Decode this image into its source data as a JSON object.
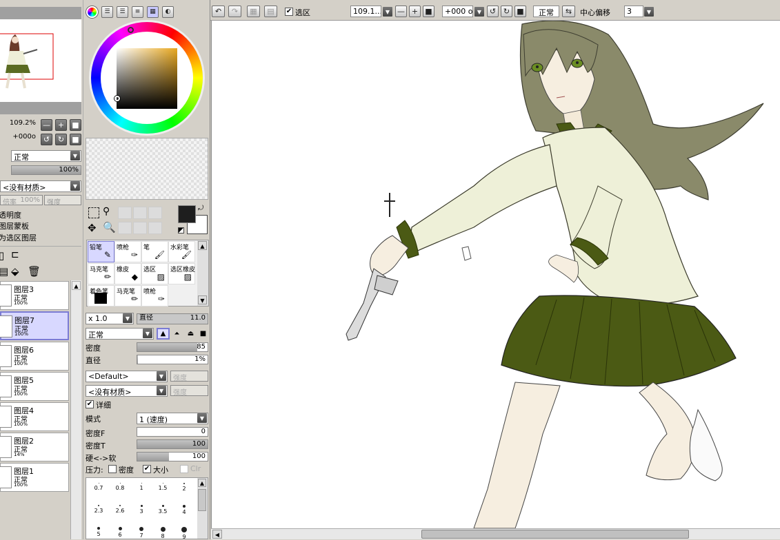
{
  "top_toolbar": {
    "selection_check": "✔",
    "selection_label": "选区",
    "zoom_value": "109.1...",
    "rotate_value": "+000 o",
    "blend_mode": "正常",
    "center_offset_label": "中心偏移",
    "center_offset_value": "3"
  },
  "navigator": {
    "zoom_value": "109.2%",
    "rotate_value": "+000o",
    "blend_mode": "正常",
    "opacity_value": "100%",
    "texture": "<没有材质>",
    "texture_scale_label": "倍率",
    "texture_scale_value": "100%",
    "texture_strength": "强度",
    "option_transparency": "透明度",
    "option_layer_template": "图层蒙板",
    "option_selection_layer": "为选区图层"
  },
  "layers": [
    {
      "name": "图层3",
      "mode": "正常",
      "opacity": "100%"
    },
    {
      "name": "图层7",
      "mode": "正常",
      "opacity": "100%"
    },
    {
      "name": "图层6",
      "mode": "正常",
      "opacity": "100%"
    },
    {
      "name": "图层5",
      "mode": "正常",
      "opacity": "100%"
    },
    {
      "name": "图层4",
      "mode": "正常",
      "opacity": "100%"
    },
    {
      "name": "图层2",
      "mode": "正常",
      "opacity": "14%"
    },
    {
      "name": "图层1",
      "mode": "正常",
      "opacity": "100%"
    }
  ],
  "tools": [
    {
      "name": "铅笔",
      "icon": "pencil-icon"
    },
    {
      "name": "喷枪",
      "icon": "airbrush-icon"
    },
    {
      "name": "笔",
      "icon": "brush-icon"
    },
    {
      "name": "水彩笔",
      "icon": "watercolor-icon"
    },
    {
      "name": "马克笔",
      "icon": "marker-icon"
    },
    {
      "name": "橡皮",
      "icon": "eraser-icon"
    },
    {
      "name": "选区",
      "icon": "select-pen-icon"
    },
    {
      "name": "选区橡皮",
      "icon": "select-eraser-icon"
    },
    {
      "name": "着色笔",
      "icon": "fill-icon"
    },
    {
      "name": "马克笔",
      "icon": "marker-icon"
    },
    {
      "name": "喷枪",
      "icon": "airbrush-icon"
    }
  ],
  "brush": {
    "size_mult": "x 1.0",
    "diameter_label": "直径",
    "diameter_value": "11.0",
    "blend_mode": "正常",
    "density_label": "密度",
    "density_value": "85",
    "density_level": 0.85,
    "min_diameter_label": "直径",
    "min_diameter_value": "1%",
    "shape": "<Default>",
    "shape_strength": "强度",
    "texture": "<没有材质>",
    "texture_strength": "强度",
    "detail_check": "✔",
    "detail_label": "详细",
    "mode_label": "模式",
    "mode_value": "1 (速度)",
    "density_f_label": "密度F",
    "density_f_value": "0",
    "density_f_level": 0,
    "density_t_label": "密度T",
    "density_t_value": "100",
    "density_t_level": 1,
    "hard_soft_label": "硬<->软",
    "hard_soft_value": "100",
    "hard_soft_level": 0.45,
    "pressure_label": "压力:",
    "pressure_density": "密度",
    "pressure_size_check": "✔",
    "pressure_size": "大小",
    "pressure_clr": "Clr"
  },
  "brush_sizes": [
    "0.7",
    "0.8",
    "1",
    "1.5",
    "2",
    "2.3",
    "2.6",
    "3",
    "3.5",
    "4",
    "5",
    "6",
    "7",
    "8",
    "9"
  ],
  "colors": {
    "accent": "#7b7bd4",
    "foreground": "#1e1e1e",
    "background": "#ffffff",
    "canvas": "#ffffff",
    "ui": "#d4d0c8"
  }
}
